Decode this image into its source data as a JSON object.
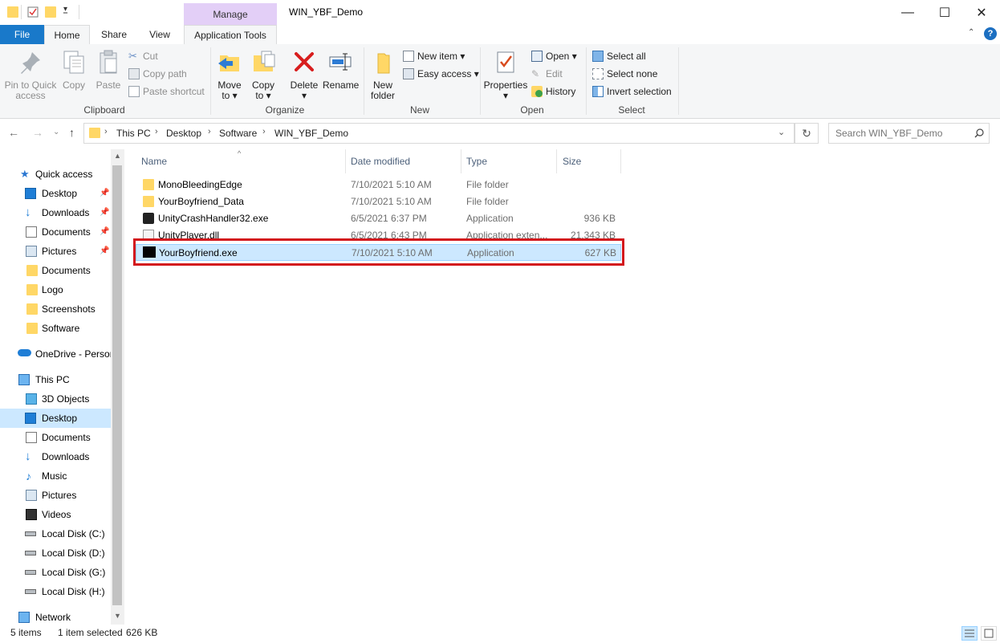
{
  "window": {
    "title": "WIN_YBF_Demo",
    "context_tab": "Manage",
    "controls": {
      "minimize": "—",
      "maximize": "☐",
      "close": "✕"
    }
  },
  "tabs": [
    "File",
    "Home",
    "Share",
    "View",
    "Application Tools"
  ],
  "ribbon": {
    "clipboard": {
      "label": "Clipboard",
      "pin_line1": "Pin to Quick",
      "pin_line2": "access",
      "copy": "Copy",
      "paste": "Paste",
      "cut": "Cut",
      "copy_path": "Copy path",
      "paste_shortcut": "Paste shortcut"
    },
    "organize": {
      "label": "Organize",
      "move_line1": "Move",
      "move_line2": "to ▾",
      "copy_line1": "Copy",
      "copy_line2": "to ▾",
      "delete": "Delete",
      "delete_arrow": "▾",
      "rename": "Rename"
    },
    "new": {
      "label": "New",
      "new_folder_line1": "New",
      "new_folder_line2": "folder",
      "new_item": "New item ▾",
      "easy_access": "Easy access ▾"
    },
    "open": {
      "label": "Open",
      "properties": "Properties",
      "properties_arrow": "▾",
      "open": "Open ▾",
      "edit": "Edit",
      "history": "History"
    },
    "select": {
      "label": "Select",
      "select_all": "Select all",
      "select_none": "Select none",
      "invert": "Invert selection"
    }
  },
  "address": {
    "crumbs": [
      "This PC",
      "Desktop",
      "Software",
      "WIN_YBF_Demo"
    ],
    "search_placeholder": "Search WIN_YBF_Demo"
  },
  "nav": {
    "quick_access": "Quick access",
    "quick_items": [
      "Desktop",
      "Downloads",
      "Documents",
      "Pictures",
      "Documents",
      "Logo",
      "Screenshots",
      "Software"
    ],
    "onedrive": "OneDrive - Persor",
    "this_pc": "This PC",
    "pc_items": [
      "3D Objects",
      "Desktop",
      "Documents",
      "Downloads",
      "Music",
      "Pictures",
      "Videos",
      "Local Disk (C:)",
      "Local Disk (D:)",
      "Local Disk (G:)",
      "Local Disk (H:)"
    ],
    "network": "Network"
  },
  "columns": {
    "name": "Name",
    "date": "Date modified",
    "type": "Type",
    "size": "Size"
  },
  "files": [
    {
      "name": "MonoBleedingEdge",
      "date": "7/10/2021 5:10 AM",
      "type": "File folder",
      "size": ""
    },
    {
      "name": "YourBoyfriend_Data",
      "date": "7/10/2021 5:10 AM",
      "type": "File folder",
      "size": ""
    },
    {
      "name": "UnityCrashHandler32.exe",
      "date": "6/5/2021 6:37 PM",
      "type": "Application",
      "size": "936 KB"
    },
    {
      "name": "UnityPlayer.dll",
      "date": "6/5/2021 6:43 PM",
      "type": "Application exten...",
      "size": "21,343 KB"
    },
    {
      "name": "YourBoyfriend.exe",
      "date": "7/10/2021 5:10 AM",
      "type": "Application",
      "size": "627 KB"
    }
  ],
  "status": {
    "items": "5 items",
    "selected": "1 item selected",
    "size": "626 KB"
  },
  "colors": {
    "accent": "#1979ca",
    "selection": "#cce8ff",
    "highlight": "#d3171d",
    "folder": "#ffd766"
  }
}
